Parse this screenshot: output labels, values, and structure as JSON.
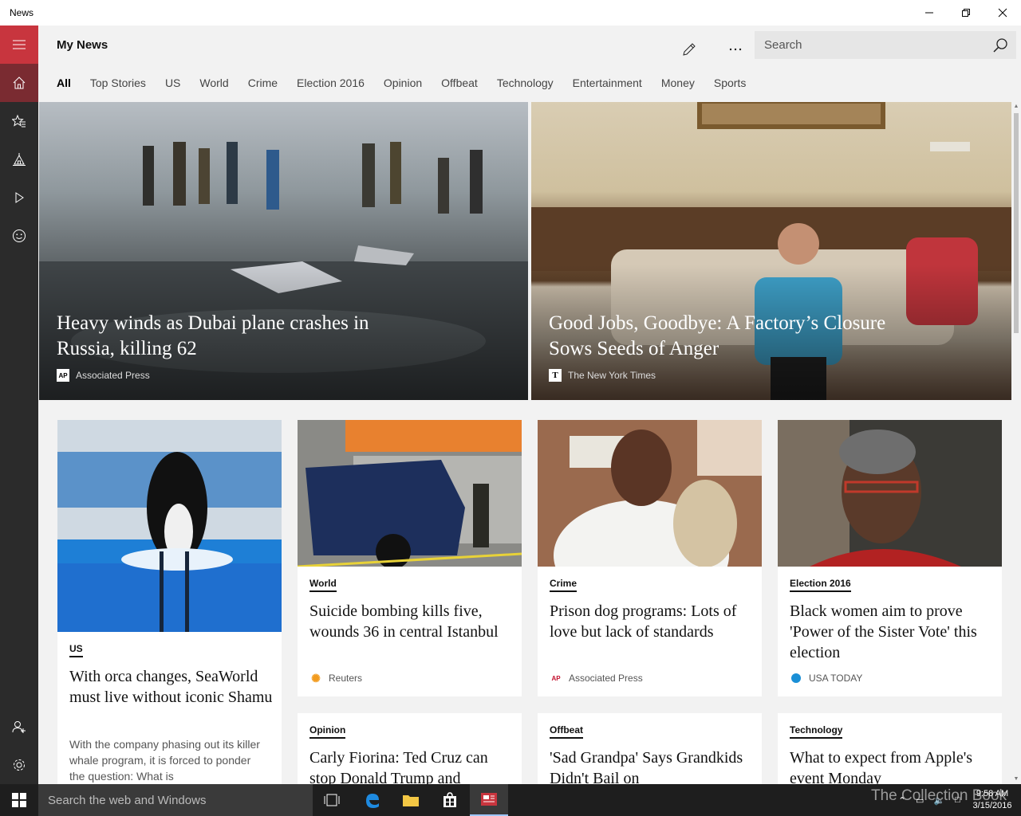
{
  "window": {
    "title": "News"
  },
  "header": {
    "title": "My News",
    "search_placeholder": "Search"
  },
  "tabs": [
    {
      "label": "All",
      "active": true
    },
    {
      "label": "Top Stories"
    },
    {
      "label": "US"
    },
    {
      "label": "World"
    },
    {
      "label": "Crime"
    },
    {
      "label": "Election 2016"
    },
    {
      "label": "Opinion"
    },
    {
      "label": "Offbeat"
    },
    {
      "label": "Technology"
    },
    {
      "label": "Entertainment"
    },
    {
      "label": "Money"
    },
    {
      "label": "Sports"
    }
  ],
  "rail": {
    "items": [
      "menu-icon",
      "home-icon",
      "favorites-icon",
      "local-icon",
      "video-icon",
      "emoji-icon",
      "add-person-icon",
      "settings-icon"
    ],
    "accent": "#c8353e",
    "active_bg": "#7a2b31"
  },
  "hero": [
    {
      "headline": "Heavy winds as Dubai plane crashes in Russia, killing 62",
      "source": "Associated Press",
      "source_logo": "AP"
    },
    {
      "headline": "Good Jobs, Goodbye: A Factory’s Closure Sows Seeds of Anger",
      "source": "The New York Times",
      "source_logo": "T"
    }
  ],
  "cards": [
    {
      "category": "US",
      "title": "With orca changes, SeaWorld must live without iconic Shamu",
      "snippet": "With the company phasing out its killer whale program, it is forced to ponder the question: What is"
    },
    {
      "category": "World",
      "title": "Suicide bombing kills five, wounds 36 in central Istanbul",
      "source": "Reuters"
    },
    {
      "category": "Crime",
      "title": "Prison dog programs: Lots of love but lack of standards",
      "source": "Associated Press",
      "source_logo": "AP"
    },
    {
      "category": "Election 2016",
      "title": "Black women aim to prove 'Power of the Sister Vote' this election",
      "source": "USA TODAY"
    },
    {
      "category": "Opinion",
      "title": "Carly Fiorina: Ted Cruz can stop Donald Trump and"
    },
    {
      "category": "Offbeat",
      "title": "'Sad Grandpa' Says Grandkids Didn't Bail on"
    },
    {
      "category": "Technology",
      "title": "What to expect from Apple's event Monday"
    }
  ],
  "taskbar": {
    "search_placeholder": "Search the web and Windows",
    "time": "9:58 AM",
    "date": "3/15/2016",
    "watermark": "The Collection Book"
  }
}
